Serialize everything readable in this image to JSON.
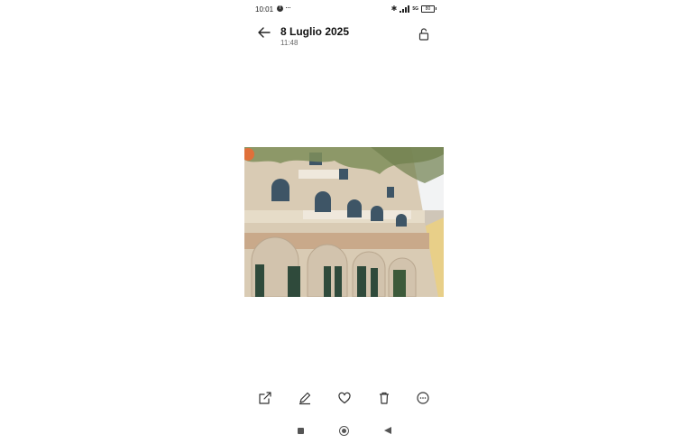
{
  "status_bar": {
    "time": "10:01",
    "more_indicator": "···",
    "network": "5G",
    "battery": "80",
    "icons": [
      "facebook-icon",
      "bluetooth-icon",
      "signal-icon",
      "battery-icon"
    ]
  },
  "header": {
    "title": "8 Luglio 2025",
    "subtitle": "11:48",
    "back_icon": "arrow-left-icon",
    "lock_icon": "lock-open-icon"
  },
  "photo": {
    "description_icon": "photo-building-facade"
  },
  "actions": [
    {
      "name": "share",
      "icon": "share-icon"
    },
    {
      "name": "edit",
      "icon": "pencil-icon"
    },
    {
      "name": "favorite",
      "icon": "heart-icon"
    },
    {
      "name": "delete",
      "icon": "trash-icon"
    },
    {
      "name": "more",
      "icon": "more-icon"
    }
  ],
  "nav": [
    "recents",
    "home",
    "back"
  ],
  "colors": {
    "background": "#ffffff",
    "icon": "#333333"
  }
}
